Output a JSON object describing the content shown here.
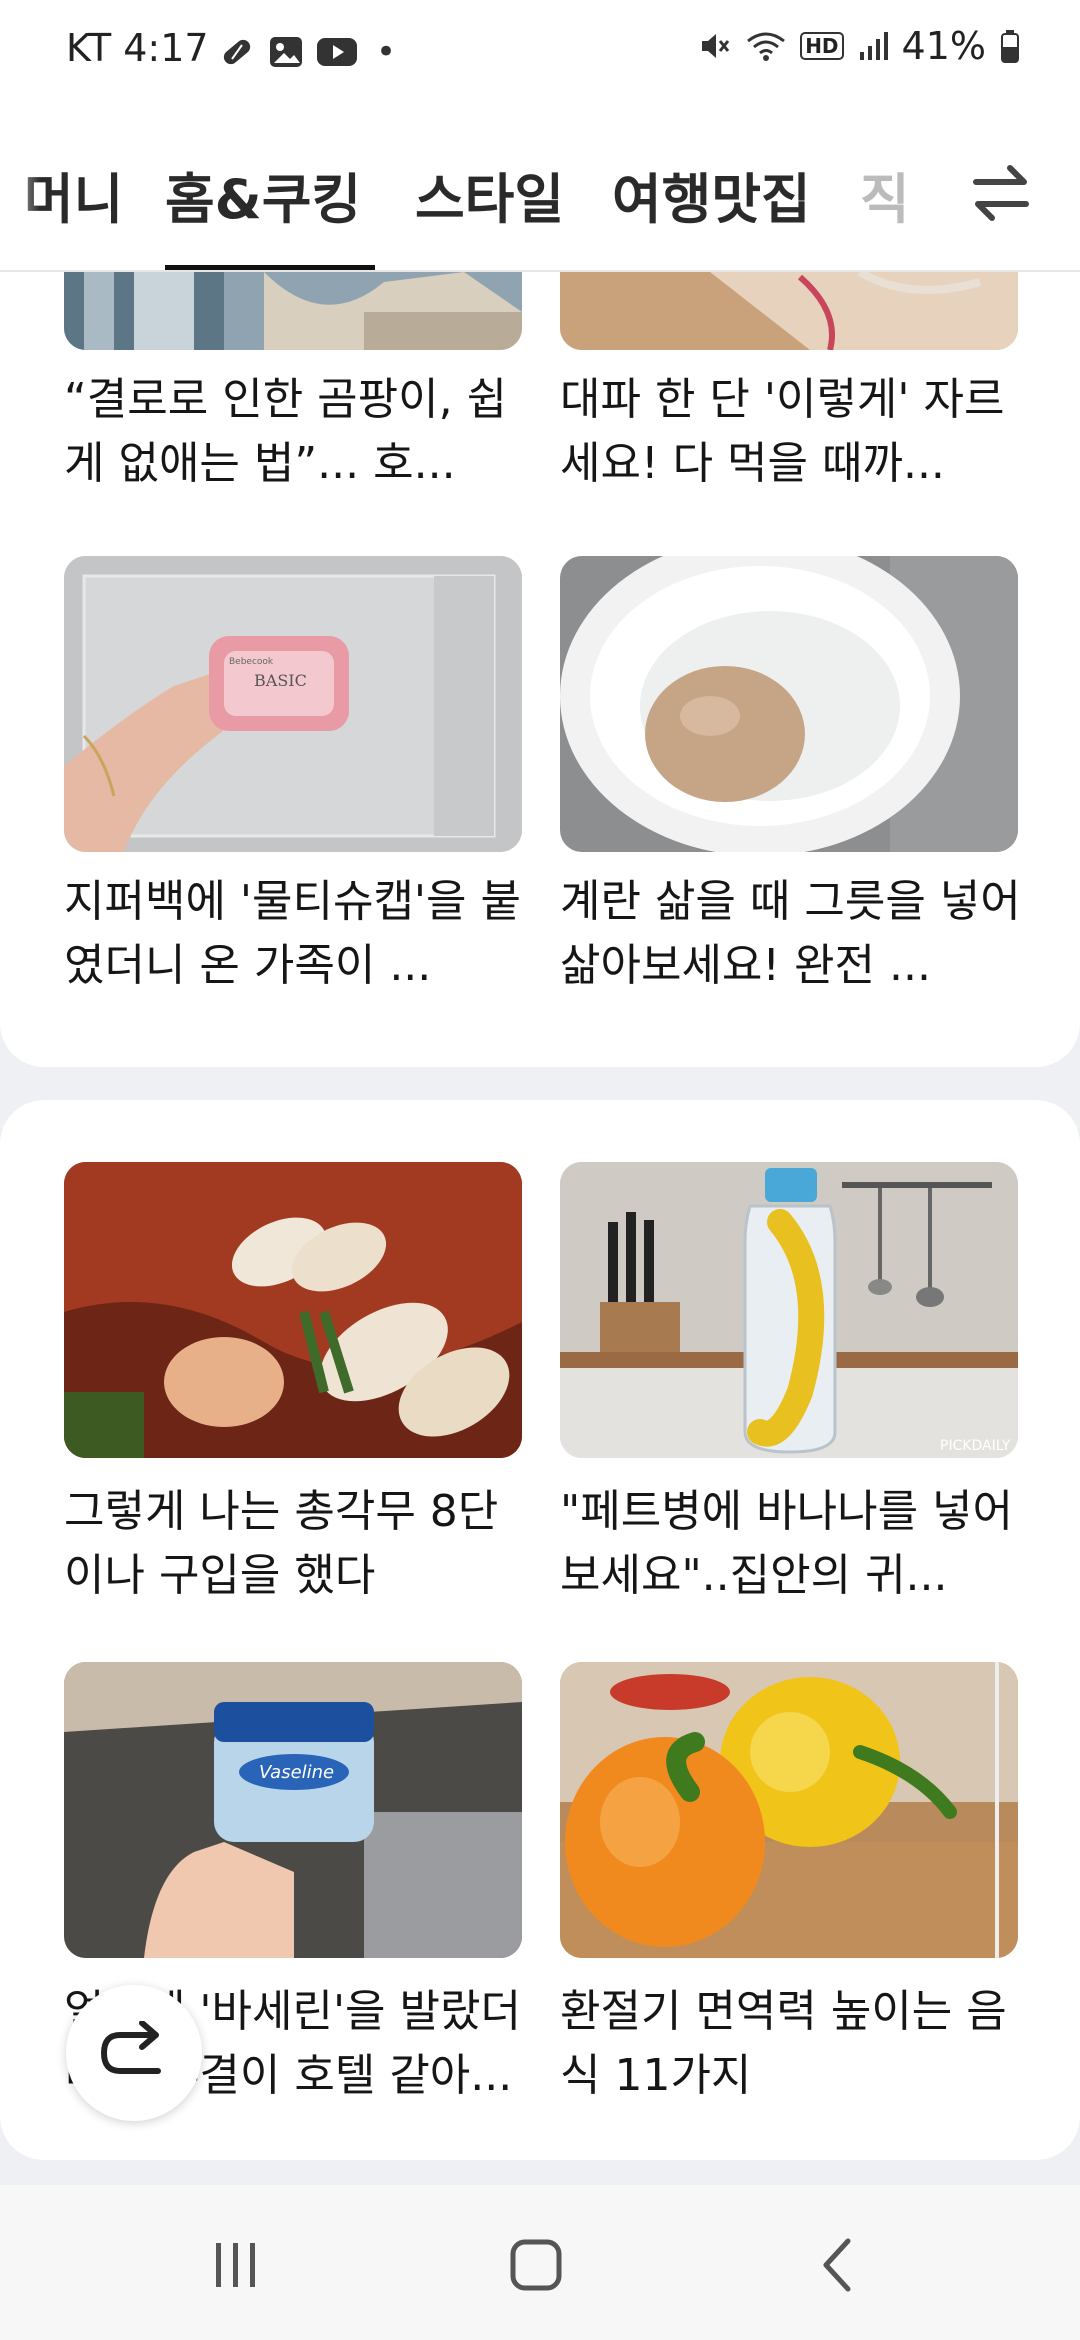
{
  "status_bar": {
    "carrier_time": "KT 4:17",
    "dot": "•",
    "battery": "41%",
    "hd_label": "HD"
  },
  "tabs": [
    {
      "label": "머니"
    },
    {
      "label": "홈&쿠킹"
    },
    {
      "label": "스타일"
    },
    {
      "label": "여행맛집"
    },
    {
      "label": "직"
    }
  ],
  "active_tab": "홈&쿠킹",
  "articles_top": [
    {
      "caption": "“결로로 인한 곰팡이, 쉽게 없애는 법”... 호..."
    },
    {
      "caption": "대파 한 단 '이렇게' 자르세요! 다 먹을 때까..."
    },
    {
      "caption": "지퍼백에 '물티슈캡'을 붙였더니 온 가족이 ..."
    },
    {
      "caption": "계란 삶을 때 그릇을 넣어 삶아보세요! 완전 ..."
    }
  ],
  "articles_bottom": [
    {
      "caption": "그렇게 나는 총각무 8단이나 구입을 했다"
    },
    {
      "caption": "\"페트병에 바나나를 넣어보세요\"..집안의 귀..."
    },
    {
      "caption": "얼굴에 '바세린'을 발랐더니 피부결이 호텔 같아..."
    },
    {
      "caption": "환절기 면역력 높이는 음식 11가지"
    }
  ],
  "thumb_texts": {
    "tissue_brand": "BASIC",
    "tissue_sub": "Bebecook",
    "vaseline": "Vaseline",
    "watermark": "PICKDAILY"
  },
  "icons": {
    "swap": "swap-arrows-icon",
    "fab": "refresh-redo-icon",
    "nav_recent": "recent-apps-icon",
    "nav_home": "home-icon",
    "nav_back": "back-icon"
  },
  "colors": {
    "background": "#eef0f3",
    "card": "#ffffff",
    "active_underline": "#111111"
  }
}
